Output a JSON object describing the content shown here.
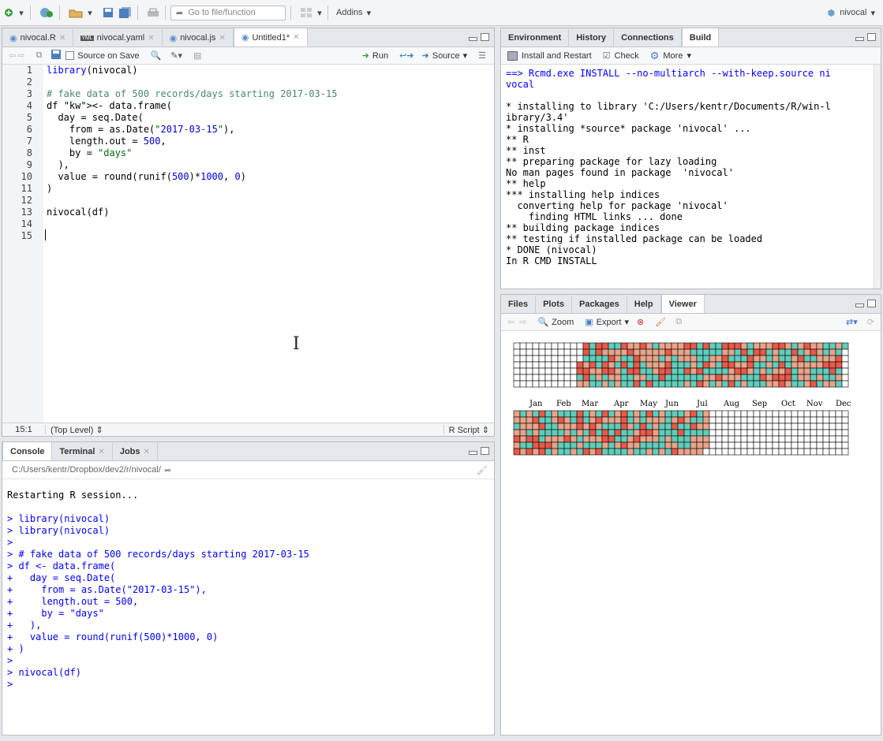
{
  "topbar": {
    "goto_placeholder": "Go to file/function",
    "addins_label": "Addins",
    "project_label": "nivocal"
  },
  "source_pane": {
    "tabs": [
      {
        "label": "nivocal.R"
      },
      {
        "label": "nivocal.yaml"
      },
      {
        "label": "nivocal.js"
      },
      {
        "label": "Untitled1*"
      }
    ],
    "source_on_save": "Source on Save",
    "run_label": "Run",
    "source_label": "Source",
    "line_numbers": [
      "1",
      "2",
      "3",
      "4",
      "5",
      "6",
      "7",
      "8",
      "9",
      "10",
      "11",
      "12",
      "13",
      "14",
      "15"
    ],
    "code_lines": [
      "library(nivocal)",
      "",
      "# fake data of 500 records/days starting 2017-03-15",
      "df <- data.frame(",
      "  day = seq.Date(",
      "    from = as.Date(\"2017-03-15\"),",
      "    length.out = 500,",
      "    by = \"days\"",
      "  ),",
      "  value = round(runif(500)*1000, 0)",
      ")",
      "",
      "nivocal(df)",
      "",
      ""
    ],
    "status_position": "15:1",
    "status_scope": "(Top Level)",
    "status_type": "R Script"
  },
  "console_pane": {
    "tabs": [
      {
        "label": "Console"
      },
      {
        "label": "Terminal"
      },
      {
        "label": "Jobs"
      }
    ],
    "path": "C:/Users/kentr/Dropbox/dev2/r/nivocal/",
    "lines": [
      "Restarting R session...",
      "",
      "> library(nivocal)",
      "> library(nivocal)",
      ">",
      "> # fake data of 500 records/days starting 2017-03-15",
      "> df <- data.frame(",
      "+   day = seq.Date(",
      "+     from = as.Date(\"2017-03-15\"),",
      "+     length.out = 500,",
      "+     by = \"days\"",
      "+   ),",
      "+   value = round(runif(500)*1000, 0)",
      "+ )",
      ">",
      "> nivocal(df)",
      "> "
    ]
  },
  "env_pane": {
    "tabs": [
      {
        "label": "Environment"
      },
      {
        "label": "History"
      },
      {
        "label": "Connections"
      },
      {
        "label": "Build"
      }
    ],
    "install_label": "Install and Restart",
    "check_label": "Check",
    "more_label": "More",
    "build_lines": [
      "==> Rcmd.exe INSTALL --no-multiarch --with-keep.source ni",
      "vocal",
      "",
      "* installing to library 'C:/Users/kentr/Documents/R/win-l",
      "ibrary/3.4'",
      "* installing *source* package 'nivocal' ...",
      "** R",
      "** inst",
      "** preparing package for lazy loading",
      "No man pages found in package  'nivocal'",
      "** help",
      "*** installing help indices",
      "  converting help for package 'nivocal'",
      "    finding HTML links ... done",
      "** building package indices",
      "** testing if installed package can be loaded",
      "* DONE (nivocal)",
      "In R CMD INSTALL"
    ]
  },
  "viewer_pane": {
    "tabs": [
      {
        "label": "Files"
      },
      {
        "label": "Plots"
      },
      {
        "label": "Packages"
      },
      {
        "label": "Help"
      },
      {
        "label": "Viewer"
      }
    ],
    "zoom_label": "Zoom",
    "export_label": "Export",
    "months": [
      "Jan",
      "Feb",
      "Mar",
      "Apr",
      "May",
      "Jun",
      "Jul",
      "Aug",
      "Sep",
      "Oct",
      "Nov",
      "Dec"
    ],
    "colors": {
      "teal": "#61cdbb",
      "salmon": "#e8a48a",
      "red": "#e8594a",
      "empty": "#ffffff"
    }
  }
}
